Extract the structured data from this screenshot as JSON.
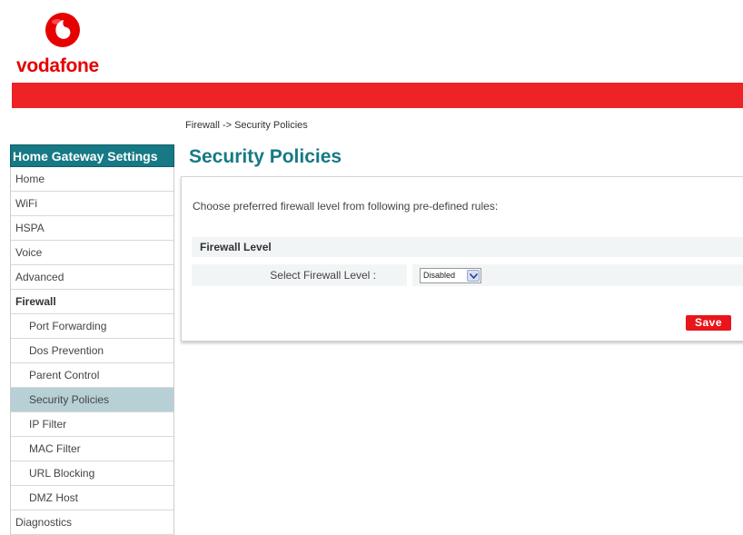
{
  "brand": {
    "logo_text": "vodafone",
    "accent_red": "#ee2326",
    "teal": "#167985",
    "active_bg": "#b7d0d6"
  },
  "breadcrumb": "Firewall -> Security Policies",
  "sidebar": {
    "header": "Home Gateway Settings",
    "items": [
      {
        "label": "Home"
      },
      {
        "label": "WiFi"
      },
      {
        "label": "HSPA"
      },
      {
        "label": "Voice"
      },
      {
        "label": "Advanced"
      },
      {
        "label": "Firewall"
      },
      {
        "label": "Port Forwarding"
      },
      {
        "label": "Dos Prevention"
      },
      {
        "label": "Parent Control"
      },
      {
        "label": "Security Policies"
      },
      {
        "label": "IP Filter"
      },
      {
        "label": "MAC Filter"
      },
      {
        "label": "URL Blocking"
      },
      {
        "label": "DMZ Host"
      },
      {
        "label": "Diagnostics"
      }
    ]
  },
  "main": {
    "title": "Security Policies",
    "intro": "Choose preferred firewall level from following pre-defined rules:",
    "section_title": "Firewall Level",
    "field_label": "Select Firewall Level :",
    "field_value": "Disabled",
    "save_label": "Save"
  }
}
